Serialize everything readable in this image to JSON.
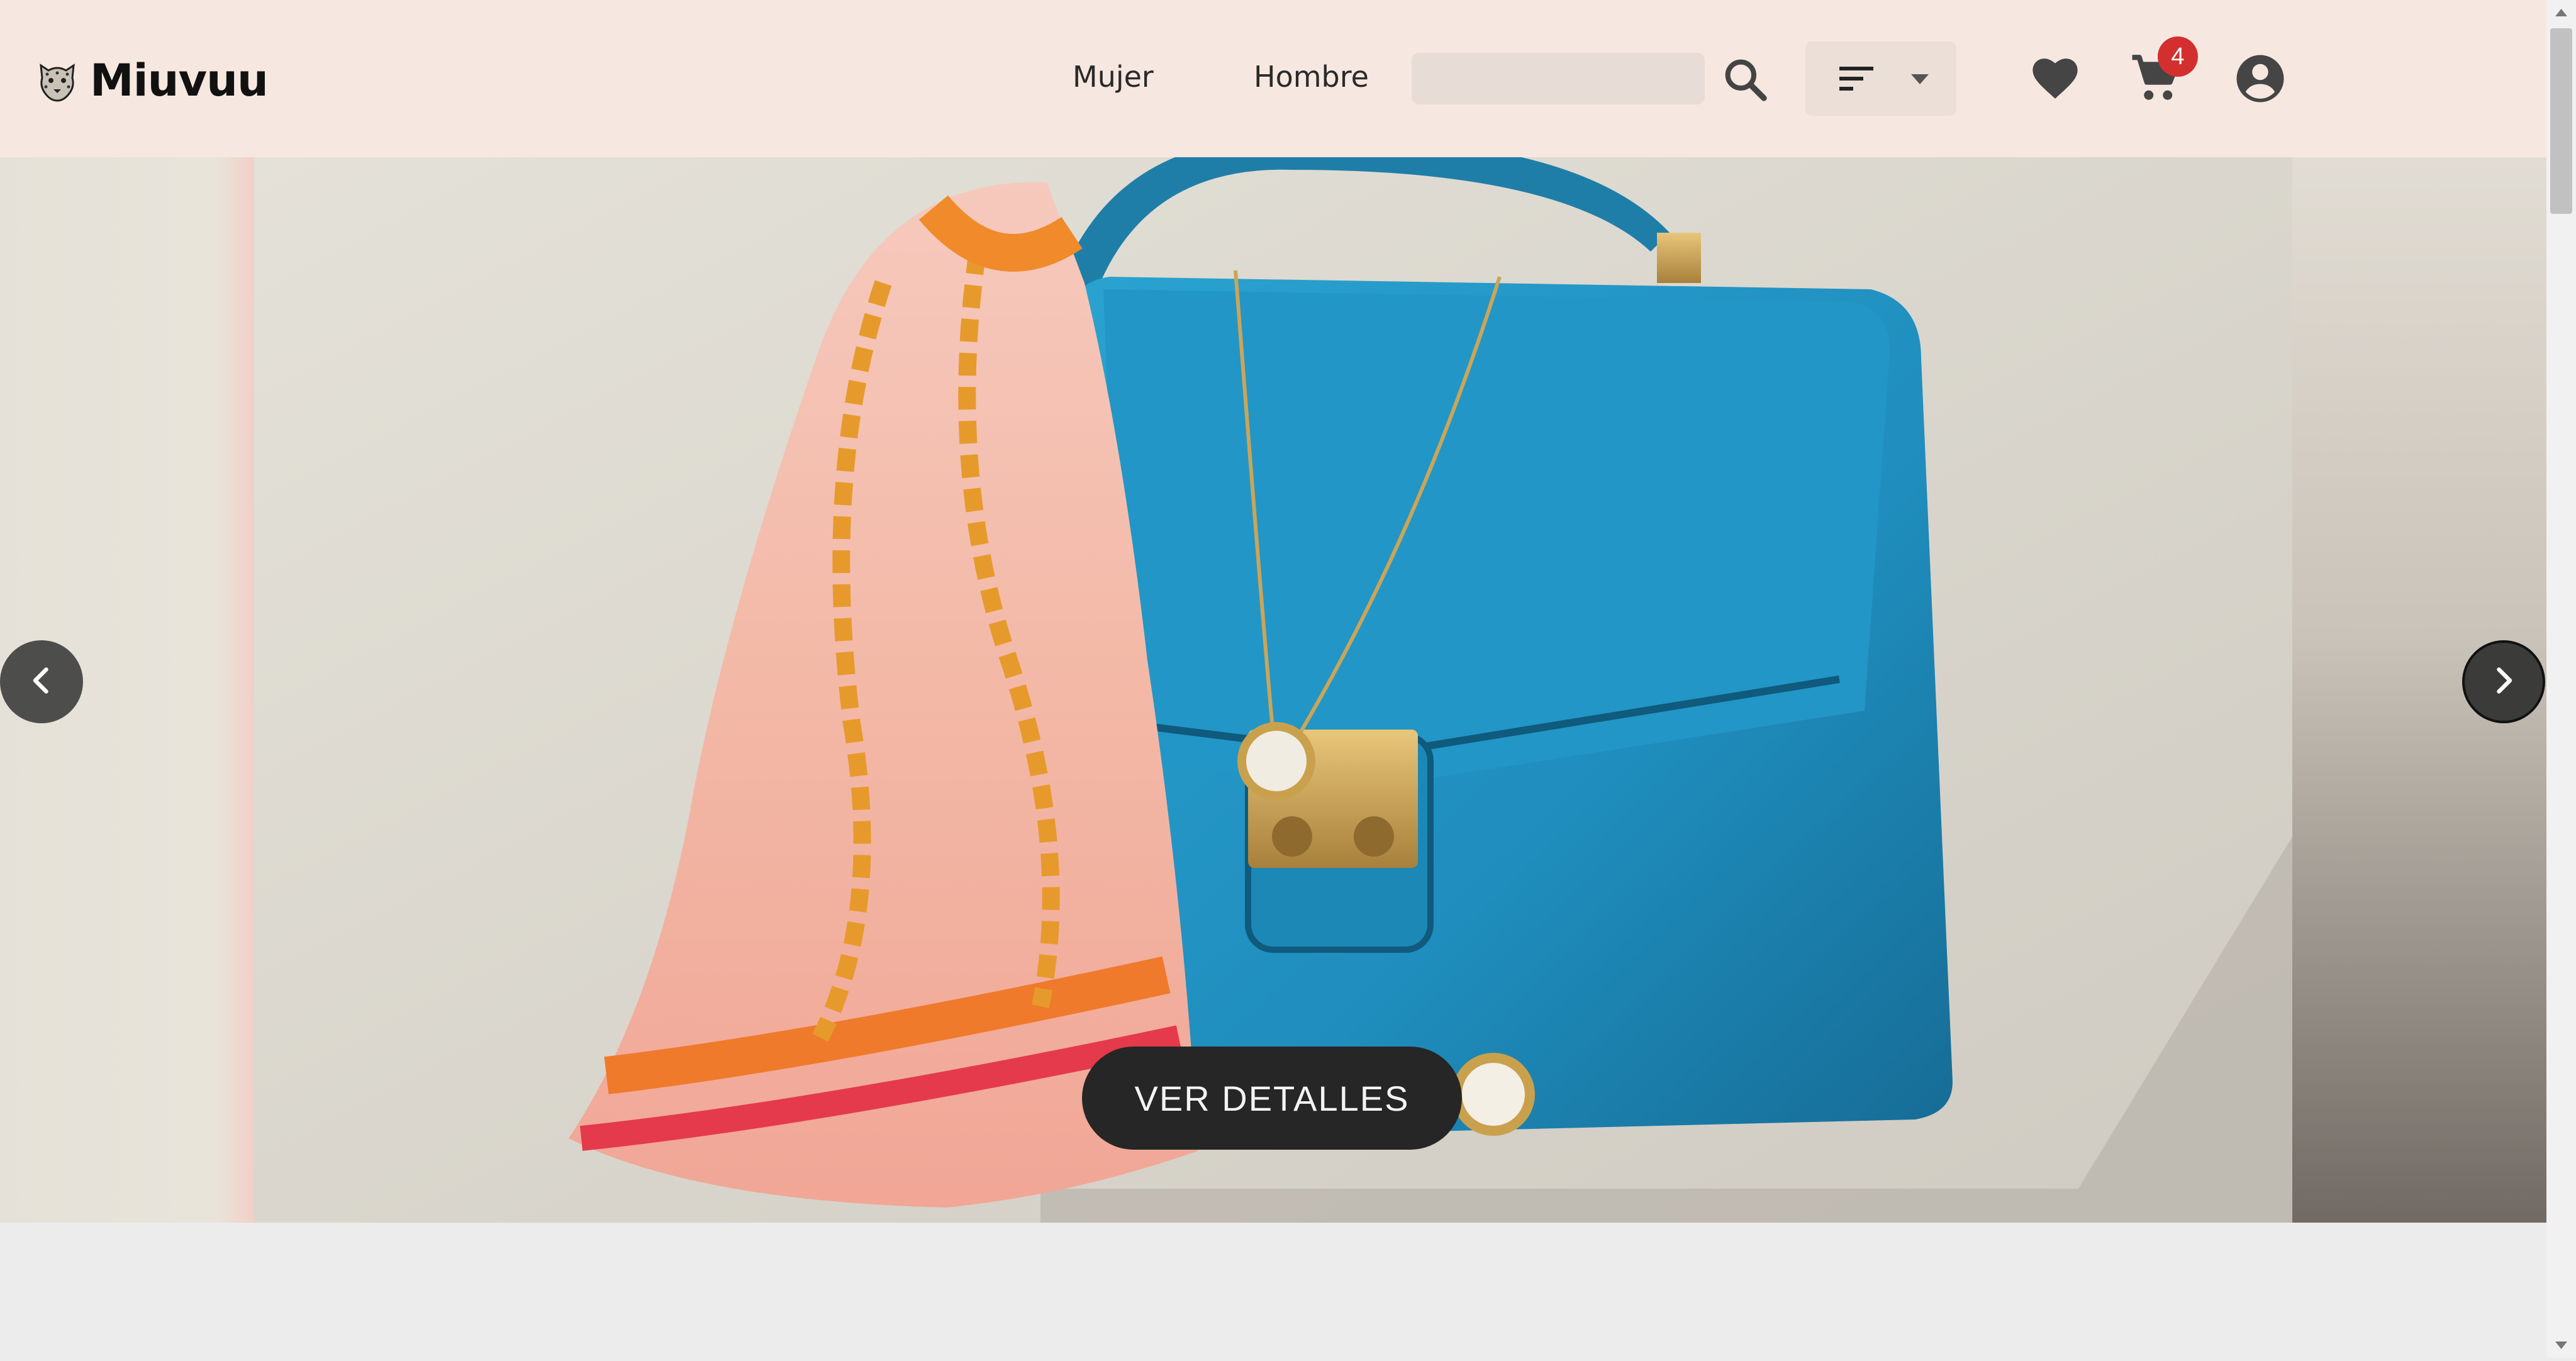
{
  "brand": {
    "name": "Miuvuu",
    "logo_icon": "leopard-head-icon"
  },
  "nav": {
    "items": [
      {
        "label": "Mujer"
      },
      {
        "label": "Hombre"
      }
    ]
  },
  "search": {
    "placeholder": "",
    "value": "",
    "icon": "search-icon"
  },
  "sort": {
    "icon": "sort-icon",
    "dropdown_icon": "caret-down-icon"
  },
  "actions": {
    "favorites_icon": "heart-icon",
    "cart_icon": "cart-icon",
    "cart_count": "4",
    "account_icon": "account-circle-icon"
  },
  "hero": {
    "cta_label": "VER DETALLES",
    "prev_icon": "chevron-left-icon",
    "next_icon": "chevron-right-icon",
    "image": "blue-handbag-with-silk-scarf-photo"
  },
  "colors": {
    "header_bg": "#f6e8e0",
    "badge": "#d32f2f",
    "cta_bg": "#262626",
    "page_bg": "#ececec"
  }
}
